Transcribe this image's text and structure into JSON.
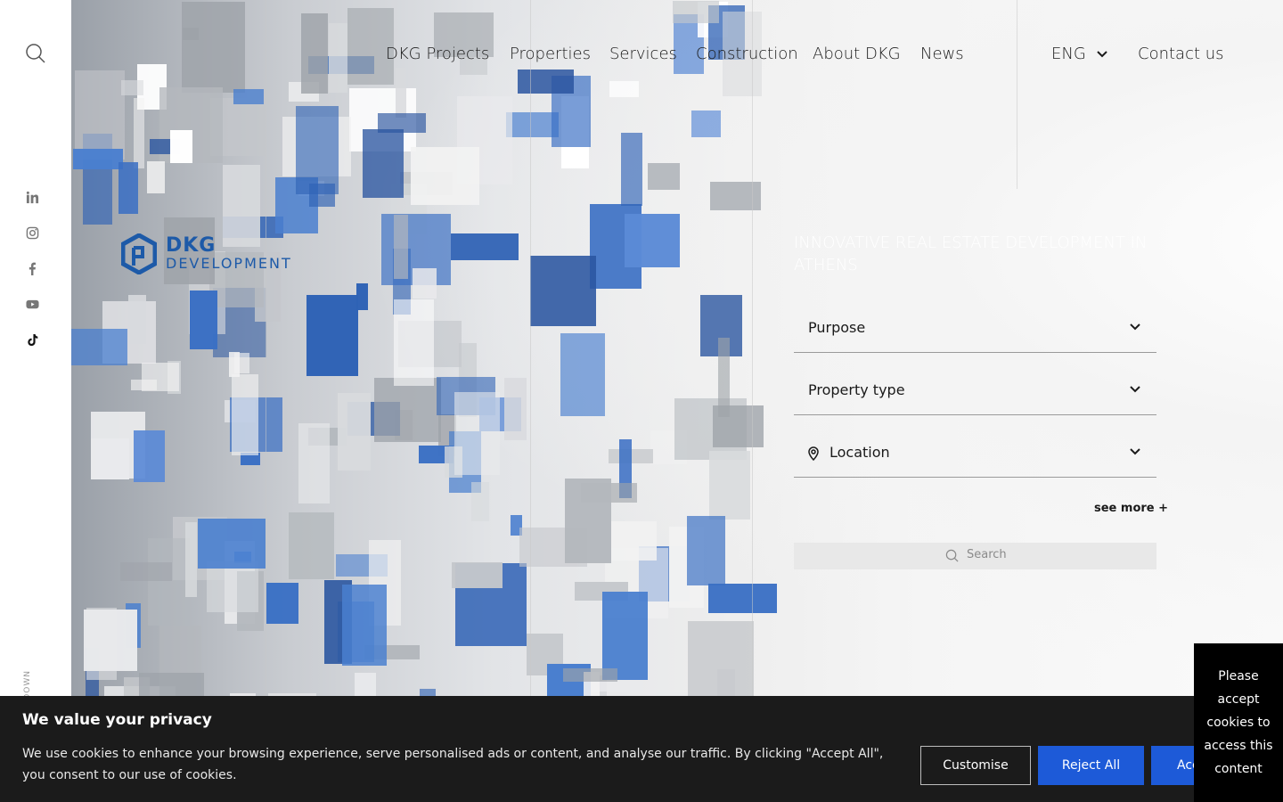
{
  "nav": {
    "items": [
      {
        "label": "DKG Projects"
      },
      {
        "label": "Properties"
      },
      {
        "label": "Services"
      },
      {
        "label": "Construction"
      },
      {
        "label": "About DKG"
      },
      {
        "label": "News"
      }
    ],
    "language": "ENG",
    "contact": "Contact us"
  },
  "social": [
    "linkedin-icon",
    "instagram-icon",
    "facebook-icon",
    "youtube-icon",
    "tiktok-icon"
  ],
  "logo": {
    "line1": "DKG",
    "line2": "DEVELOPMENT"
  },
  "hero": {
    "tagline": "INNOVATIVE REAL ESTATE DEVELOPMENT IN ATHENS",
    "scroll_label": "DOWN"
  },
  "search_form": {
    "purpose": "Purpose",
    "property_type": "Property type",
    "location": "Location",
    "see_more": "see more +",
    "search_placeholder": "Search"
  },
  "cookie": {
    "title": "We value your privacy",
    "text": "We use cookies to enhance your browsing experience, serve personalised ads or content, and analyse our traffic. By clicking \"Accept All\", you consent to our use of cookies.",
    "customise": "Customise",
    "reject": "Reject All",
    "accept": "Accept All"
  },
  "notice": "Please accept cookies to access this content",
  "colors": {
    "brand": "#1d5aa8",
    "button": "#1d5ad8",
    "banner": "#1b1b1b"
  }
}
